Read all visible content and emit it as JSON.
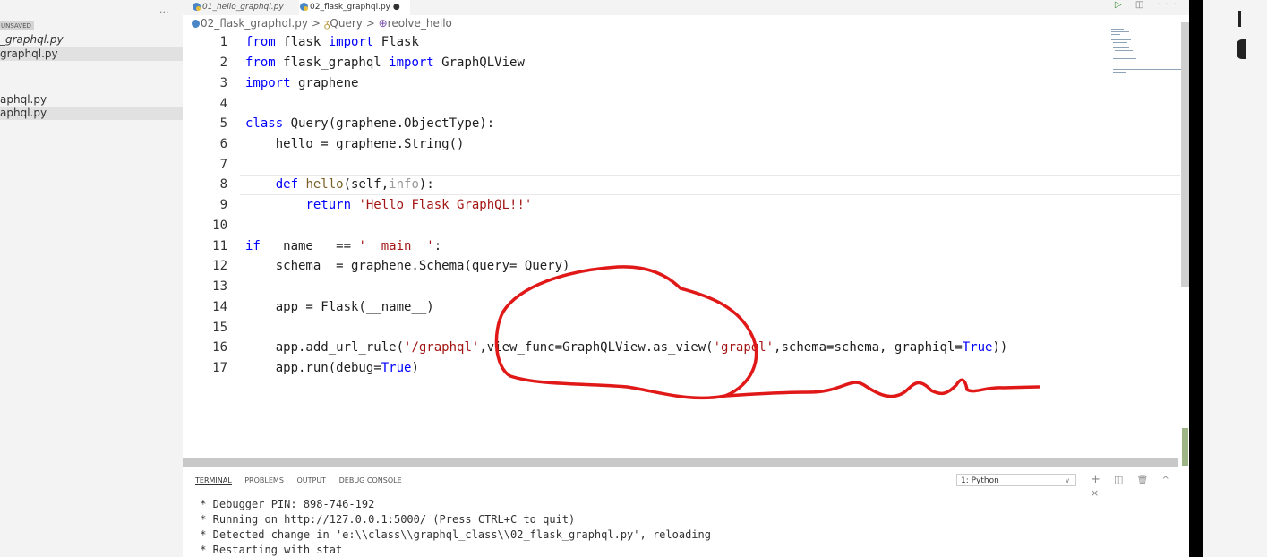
{
  "sidebar": {
    "more_label": "...",
    "unsaved_label": "UNSAVED",
    "files": [
      {
        "label": "_graphql.py"
      },
      {
        "label": "graphql.py"
      },
      {
        "label": "aphql.py"
      },
      {
        "label": "aphql.py"
      }
    ]
  },
  "tabs": [
    {
      "label": "01_hello_graphql.py"
    },
    {
      "label": "02_flask_graphql.py ●"
    }
  ],
  "run_actions": {
    "run": "▷",
    "split": "◫",
    "more": "···"
  },
  "breadcrumb": {
    "file": "02_flask_graphql.py",
    "sep1": ">",
    "class_icon": "ᵹ",
    "class_name": "Query",
    "sep2": ">",
    "method_icon": "⊕",
    "method_name": "reolve_hello"
  },
  "code_lines": [
    {
      "num": "1"
    },
    {
      "num": "2"
    },
    {
      "num": "3"
    },
    {
      "num": "4"
    },
    {
      "num": "5"
    },
    {
      "num": "6"
    },
    {
      "num": "7"
    },
    {
      "num": "8"
    },
    {
      "num": "9"
    },
    {
      "num": "10"
    },
    {
      "num": "11"
    },
    {
      "num": "12"
    },
    {
      "num": "13"
    },
    {
      "num": "14"
    },
    {
      "num": "15"
    },
    {
      "num": "16"
    },
    {
      "num": "17"
    }
  ],
  "code": {
    "l1": {
      "kw1": "from",
      "mod": " flask ",
      "kw2": "import",
      "name": " Flask"
    },
    "l2": {
      "kw1": "from",
      "mod": " flask_graphql ",
      "kw2": "import",
      "name": " GraphQLView"
    },
    "l3": {
      "kw1": "import",
      "name": " graphene"
    },
    "l5": {
      "kw": "class",
      "rest": " Query(graphene.ObjectType):"
    },
    "l6": {
      "text": "    hello = graphene.String()"
    },
    "l8": {
      "indent": "    ",
      "kw": "def",
      "fn": " hello",
      "args1": "(self,",
      "dim": "info",
      "args2": "):"
    },
    "l9": {
      "indent": "        ",
      "kw": "return",
      "str": " 'Hello Flask GraphQL!!'"
    },
    "l11": {
      "kw": "if",
      "mid": " __name__ == ",
      "str": "'__main__'",
      "end": ":"
    },
    "l12": {
      "text": "    schema  = graphene.Schema(query= Query)"
    },
    "l14": {
      "text": "    app = Flask(__name__)"
    },
    "l16": {
      "pre": "    app.add_url_rule(",
      "str1": "'/graphql'",
      "mid": ",view_func=GraphQLView.as_view(",
      "str2": "'grapql'",
      "post": ",schema=schema, graphiql=",
      "bool": "True",
      "end": "))"
    },
    "l17": {
      "pre": "    app.run(debug=",
      "bool": "True",
      "end": ")"
    }
  },
  "terminal": {
    "tabs": [
      "TERMINAL",
      "PROBLEMS",
      "OUTPUT",
      "DEBUG CONSOLE"
    ],
    "shell_select": "1: Python",
    "actions": {
      "add": "+",
      "split": "◫",
      "trash": "🗑",
      "up": "^",
      "close": "×"
    },
    "lines": [
      " * Debugger PIN: 898-746-192",
      " * Running on http://127.0.0.1:5000/ (Press CTRL+C to quit)",
      " * Detected change in 'e:\\\\class\\\\graphql_class\\\\02_flask_graphql.py', reloading",
      " * Restarting with stat"
    ]
  },
  "colors": {
    "annotation": "#e01818",
    "keyword": "#0000ff",
    "string": "#a31515",
    "function": "#795e26"
  }
}
